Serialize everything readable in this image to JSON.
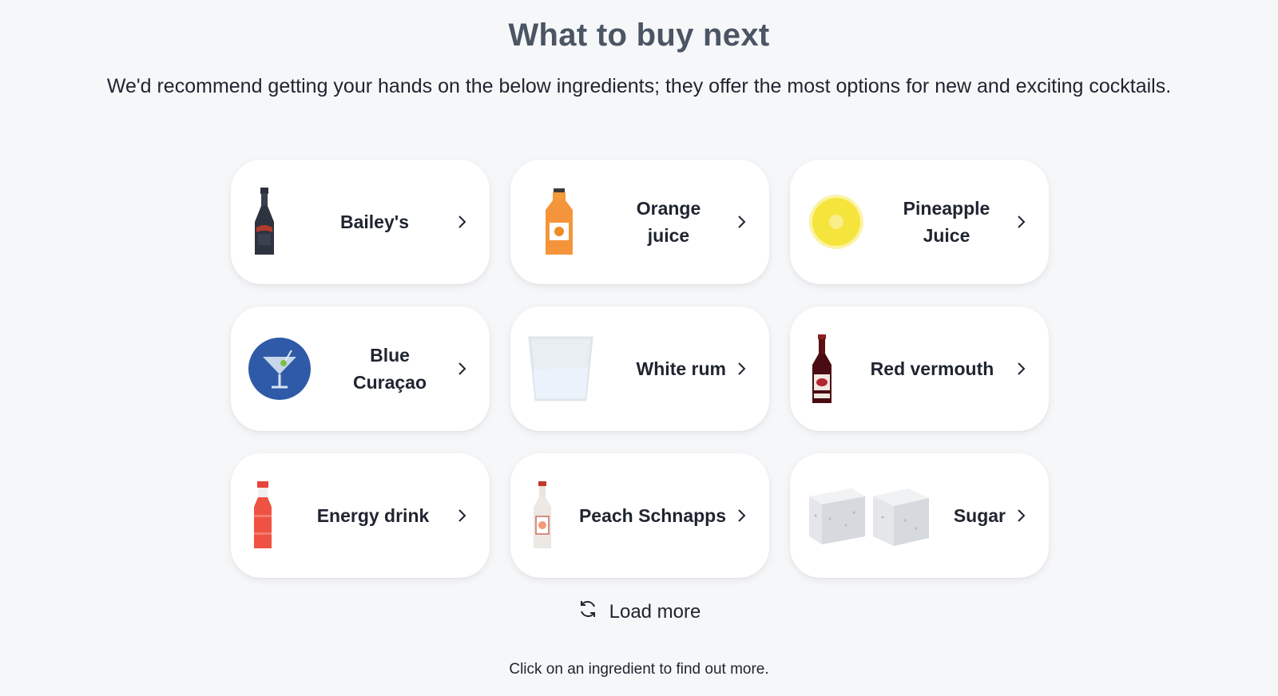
{
  "header": {
    "title": "What to buy next",
    "subtitle": "We'd recommend getting your hands on the below ingredients; they offer the most options for new and exciting cocktails."
  },
  "ingredients": [
    {
      "label_line1": "Bailey's",
      "label_line2": "",
      "icon": "baileys-bottle-icon"
    },
    {
      "label_line1": "Orange",
      "label_line2": "juice",
      "icon": "orange-juice-bottle-icon"
    },
    {
      "label_line1": "Pineapple",
      "label_line2": "Juice",
      "icon": "pineapple-juice-icon"
    },
    {
      "label_line1": "Blue",
      "label_line2": "Curaçao",
      "icon": "blue-curacao-glass-icon"
    },
    {
      "label_line1": "White rum",
      "label_line2": "",
      "icon": "white-rum-glass-icon"
    },
    {
      "label_line1": "Red vermouth",
      "label_line2": "",
      "icon": "red-vermouth-bottle-icon"
    },
    {
      "label_line1": "Energy drink",
      "label_line2": "",
      "icon": "energy-drink-bottle-icon"
    },
    {
      "label_line1": "Peach Schnapps",
      "label_line2": "",
      "icon": "peach-schnapps-bottle-icon"
    },
    {
      "label_line1": "Sugar",
      "label_line2": "",
      "icon": "sugar-cubes-icon"
    }
  ],
  "load_more": {
    "label": "Load more",
    "icon": "refresh-icon"
  },
  "footer": {
    "text": "Click on an ingredient to find out more."
  },
  "colors": {
    "background": "#f6f7f9",
    "card": "#ffffff",
    "title": "#4b5563",
    "text": "#1f2430"
  }
}
